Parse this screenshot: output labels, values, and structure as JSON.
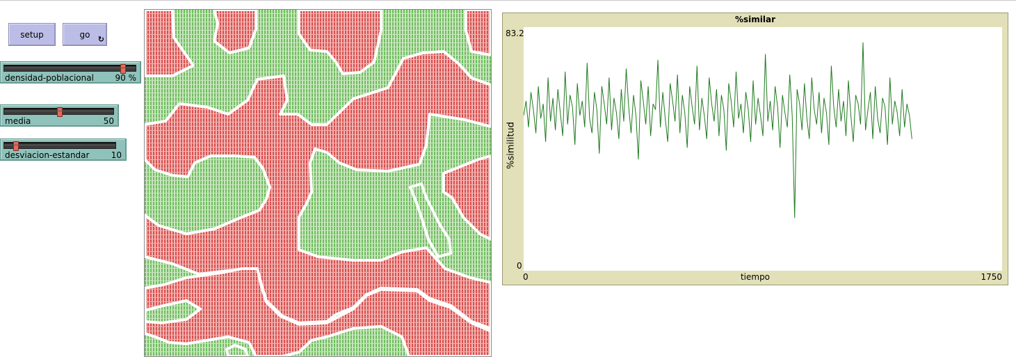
{
  "buttons": {
    "setup": "setup",
    "go": "go",
    "go_forever_icon": "forever-arrows-icon"
  },
  "sliders": [
    {
      "label": "densidad-poblacional",
      "value": "90 %",
      "fraction": 0.9
    },
    {
      "label": "media",
      "value": "50",
      "fraction": 0.5
    },
    {
      "label": "desviacion-estandar",
      "value": "10",
      "fraction": 0.1
    }
  ],
  "world": {
    "colors": {
      "red": "#e05a5a",
      "green": "#7ec36e",
      "empty": "#ffffff"
    }
  },
  "plot": {
    "title": "%similar",
    "ylabel": "%similitud",
    "xlabel": "tiempo",
    "ymin_label": "0",
    "ymax_label": "83.2",
    "xmin_label": "0",
    "xmax_label": "1750",
    "line_color": "#1f7a1f"
  },
  "chart_data": {
    "type": "line",
    "title": "%similar",
    "xlabel": "tiempo",
    "ylabel": "%similitud",
    "xlim": [
      0,
      1750
    ],
    "ylim": [
      0,
      83.2
    ],
    "grid": false,
    "series": [
      {
        "color": "#1f7a1f",
        "x_range": [
          0,
          1420
        ],
        "typical_range": [
          45,
          65
        ],
        "min": 15,
        "max": 83,
        "values": [
          53,
          58,
          49,
          61,
          55,
          47,
          63,
          52,
          57,
          44,
          66,
          51,
          59,
          48,
          62,
          54,
          46,
          68,
          50,
          60,
          56,
          43,
          64,
          53,
          58,
          49,
          71,
          52,
          47,
          61,
          55,
          40,
          63,
          57,
          50,
          66,
          48,
          59,
          54,
          45,
          62,
          51,
          69,
          56,
          47,
          60,
          53,
          38,
          65,
          58,
          50,
          63,
          46,
          57,
          55,
          72,
          49,
          61,
          52,
          44,
          64,
          58,
          51,
          67,
          47,
          60,
          54,
          42,
          63,
          56,
          50,
          70,
          48,
          59,
          53,
          45,
          66,
          57,
          51,
          62,
          46,
          60,
          55,
          41,
          64,
          58,
          49,
          68,
          52,
          57,
          47,
          61,
          55,
          44,
          65,
          50,
          59,
          53,
          46,
          74,
          51,
          58,
          48,
          63,
          56,
          42,
          60,
          54,
          49,
          67,
          53,
          18,
          62,
          57,
          48,
          64,
          52,
          45,
          66,
          55,
          50,
          61,
          47,
          59,
          54,
          43,
          70,
          56,
          49,
          62,
          51,
          58,
          46,
          65,
          53,
          44,
          60,
          57,
          50,
          78,
          48,
          55,
          61,
          45,
          63,
          52,
          47,
          59,
          56,
          43,
          66,
          50,
          58,
          54,
          46,
          62,
          49,
          57,
          53,
          45
        ]
      }
    ]
  }
}
